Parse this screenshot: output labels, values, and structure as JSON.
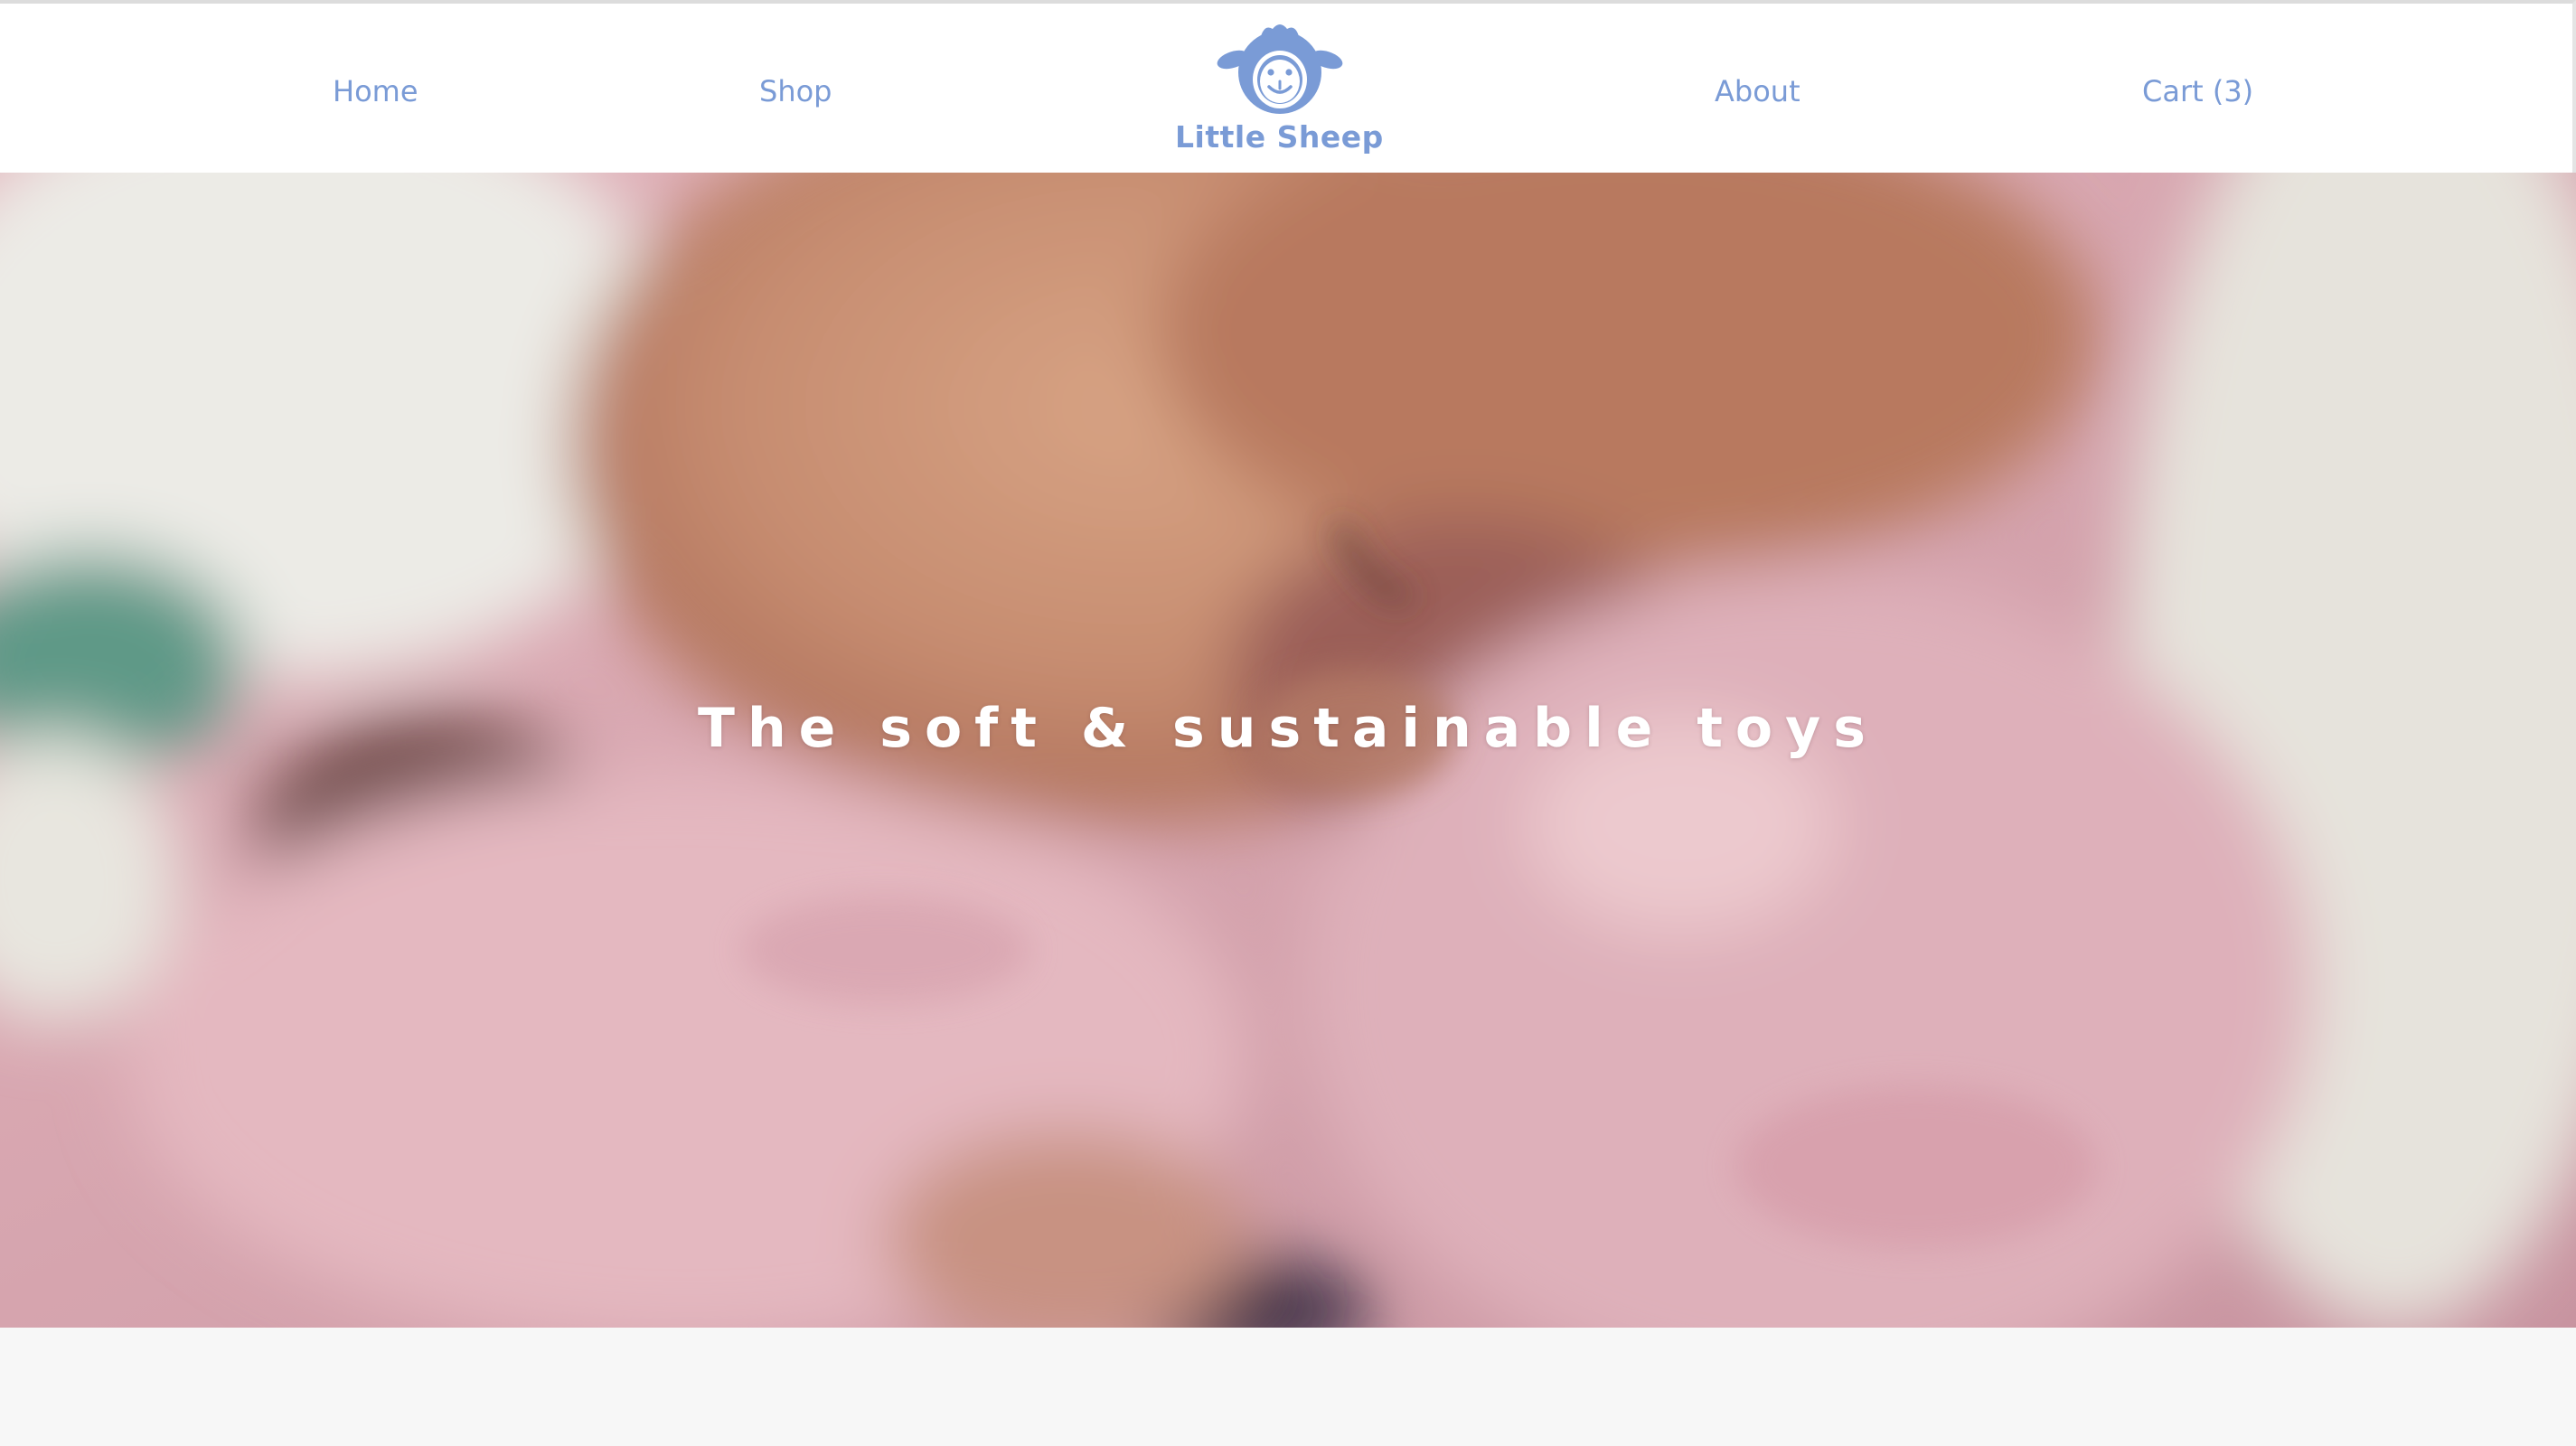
{
  "header": {
    "nav": {
      "home": "Home",
      "shop": "Shop",
      "about": "About",
      "cart": "Cart (3)"
    },
    "brand": {
      "name": "Little Sheep",
      "logo_icon": "sheep-face-icon"
    }
  },
  "hero": {
    "title": "The soft & sustainable toys",
    "image": "baby-with-pink-plush-photo"
  },
  "colors": {
    "accent": "#7a9bd6",
    "header_bg": "#ffffff",
    "page_bg": "#f7f7f7",
    "hero_text": "#ffffff"
  }
}
